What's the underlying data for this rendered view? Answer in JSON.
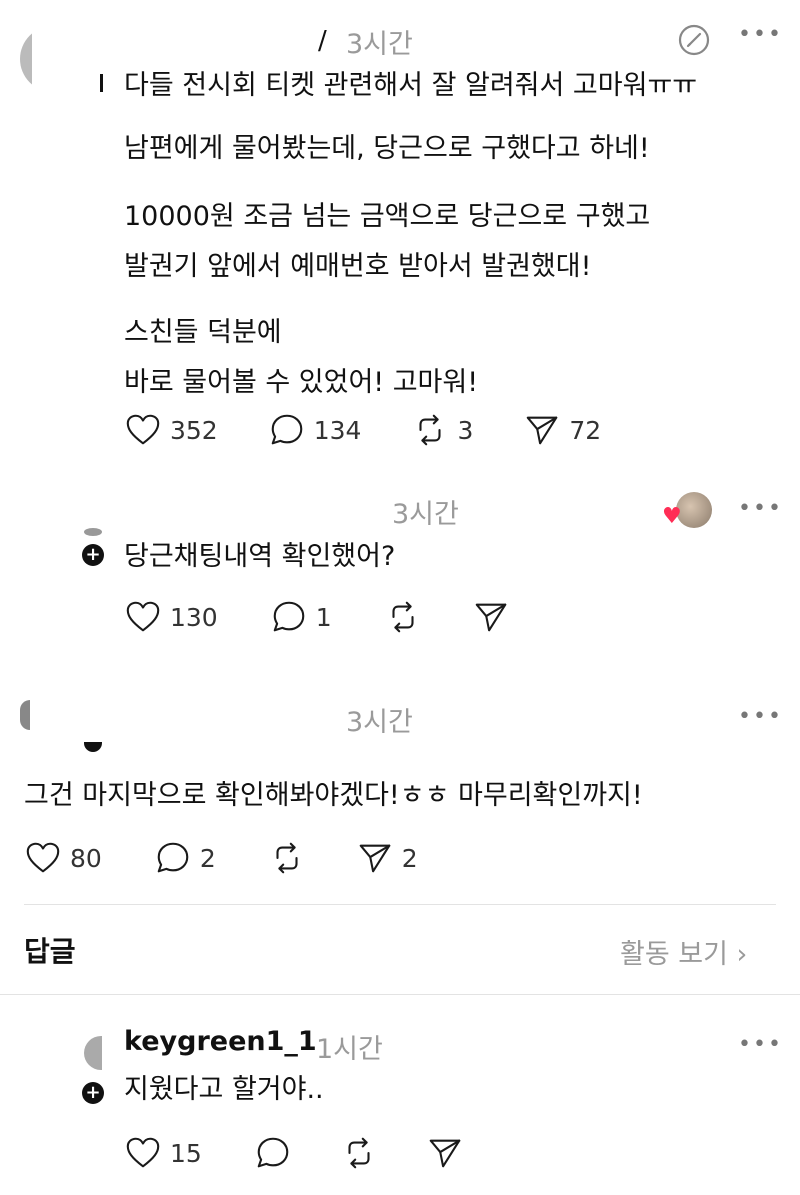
{
  "post": {
    "time": "3시간",
    "paragraphs": [
      "다들 전시회 티켓 관련해서 잘 알려줘서 고마워ㅠㅠ",
      "남편에게 물어봤는데, 당근으로 구했다고 하네!",
      "10000원 조금 넘는 금액으로 당근으로 구했고\n발권기 앞에서 예매번호 받아서 발권했대!",
      "스친들 덕분에\n바로 물어볼 수 있었어! 고마워!"
    ],
    "likes": "352",
    "comments": "134",
    "reposts": "3",
    "shares": "72"
  },
  "reply1": {
    "time": "3시간",
    "text": "당근채팅내역 확인했어?",
    "likes": "130",
    "comments": "1"
  },
  "reply2": {
    "time": "3시간",
    "text": "그건 마지막으로 확인해봐야겠다!ㅎㅎ 마무리확인까지!",
    "likes": "80",
    "comments": "2",
    "shares": "2"
  },
  "section": {
    "title": "답글",
    "activity_link": "활동 보기 ›"
  },
  "reply3": {
    "username": "keygreen1_1",
    "time": "1시간",
    "text": "지웠다고 할거야..",
    "likes": "15"
  },
  "icons": {
    "like": "heart-icon",
    "comment": "comment-bubble-icon",
    "repost": "repost-icon",
    "share": "send-icon",
    "edit": "edit-icon",
    "more": "more-dots-icon"
  }
}
